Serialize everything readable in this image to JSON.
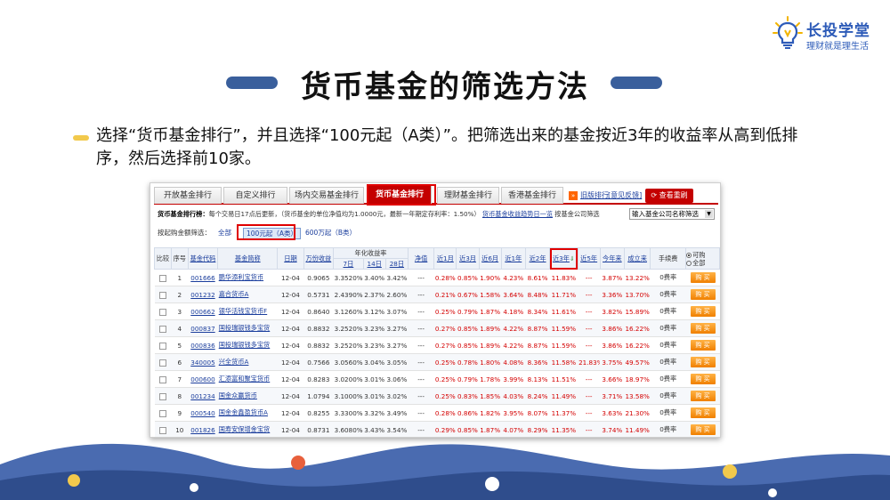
{
  "logo": {
    "brand": "长投学堂",
    "slogan": "理财就是理生活"
  },
  "title": "货币基金的筛选方法",
  "description": "选择“货币基金排行”，并且选择“100元起（A类）”。把筛选出来的基金按近3年的收益率从高到低排序，然后选择前10家。",
  "tabs": [
    {
      "label": "开放基金排行"
    },
    {
      "label": "自定义排行"
    },
    {
      "label": "场内交易基金排行"
    },
    {
      "label": "货币基金排行"
    },
    {
      "label": "理财基金排行"
    },
    {
      "label": "香港基金排行"
    }
  ],
  "tab_links": {
    "prev": "旧版排行",
    "feedback": "[意见反馈]",
    "red_button": "查看重刷"
  },
  "info": {
    "heading": "货币基金排行榜：",
    "text": "每个交易日17点后更新，（货币基金的单位净值均为1.0000元，最新一年期定存利率：1.50%）",
    "link": "货币基金收益趋势日一览",
    "company_label": "按基金公司筛选",
    "company_select": "输入基金公司名称筛选"
  },
  "filter": {
    "label": "按起购金额筛选：",
    "options": [
      "全部",
      "100元起（A类）",
      "600万起（B类）"
    ]
  },
  "table": {
    "headers": {
      "compare": "比较",
      "seq": "序号",
      "code": "基金代码",
      "name": "基金简称",
      "date": "日期",
      "wan": "万份收益",
      "annual": "年化收益率",
      "d7": "7日",
      "d14": "14日",
      "d28": "28日",
      "nav": "净值",
      "m1": "近1月",
      "m3": "近3月",
      "m6": "近6月",
      "y1": "近1年",
      "y2": "近2年",
      "y3": "近3年",
      "y5": "近5年",
      "ytd": "今年来",
      "since": "成立来",
      "fee": "手续费",
      "opt_buy": "可购",
      "opt_all": "全部"
    },
    "buy_label": "购 买",
    "rows": [
      {
        "seq": "1",
        "code": "001666",
        "name": "鹏华添利宝货币",
        "date": "12-04",
        "wan": "0.9065",
        "d7": "3.3520%",
        "d14": "3.40%",
        "d28": "3.42%",
        "nav": "---",
        "m1": "0.28%",
        "m3": "0.85%",
        "m6": "1.90%",
        "y1": "4.23%",
        "y2": "8.61%",
        "y3": "11.83%",
        "y5": "---",
        "ytd": "3.87%",
        "since": "13.22%",
        "fee": "0费率"
      },
      {
        "seq": "2",
        "code": "001232",
        "name": "嘉合货币A",
        "date": "12-04",
        "wan": "0.5731",
        "d7": "2.4390%",
        "d14": "2.37%",
        "d28": "2.60%",
        "nav": "---",
        "m1": "0.21%",
        "m3": "0.67%",
        "m6": "1.58%",
        "y1": "3.64%",
        "y2": "8.48%",
        "y3": "11.71%",
        "y5": "---",
        "ytd": "3.36%",
        "since": "13.70%",
        "fee": "0费率"
      },
      {
        "seq": "3",
        "code": "000662",
        "name": "银华活钱宝货币F",
        "date": "12-04",
        "wan": "0.8640",
        "d7": "3.1260%",
        "d14": "3.12%",
        "d28": "3.07%",
        "nav": "---",
        "m1": "0.25%",
        "m3": "0.79%",
        "m6": "1.87%",
        "y1": "4.18%",
        "y2": "8.34%",
        "y3": "11.61%",
        "y5": "---",
        "ytd": "3.82%",
        "since": "15.89%",
        "fee": "0费率"
      },
      {
        "seq": "4",
        "code": "000837",
        "name": "国投瑞银钱多宝货",
        "date": "12-04",
        "wan": "0.8832",
        "d7": "3.2520%",
        "d14": "3.23%",
        "d28": "3.27%",
        "nav": "---",
        "m1": "0.27%",
        "m3": "0.85%",
        "m6": "1.89%",
        "y1": "4.22%",
        "y2": "8.87%",
        "y3": "11.59%",
        "y5": "---",
        "ytd": "3.86%",
        "since": "16.22%",
        "fee": "0费率"
      },
      {
        "seq": "5",
        "code": "000836",
        "name": "国投瑞银钱多宝货",
        "date": "12-04",
        "wan": "0.8832",
        "d7": "3.2520%",
        "d14": "3.23%",
        "d28": "3.27%",
        "nav": "---",
        "m1": "0.27%",
        "m3": "0.85%",
        "m6": "1.89%",
        "y1": "4.22%",
        "y2": "8.87%",
        "y3": "11.59%",
        "y5": "---",
        "ytd": "3.86%",
        "since": "16.22%",
        "fee": "0费率"
      },
      {
        "seq": "6",
        "code": "340005",
        "name": "兴全货币A",
        "date": "12-04",
        "wan": "0.7566",
        "d7": "3.0560%",
        "d14": "3.04%",
        "d28": "3.05%",
        "nav": "---",
        "m1": "0.25%",
        "m3": "0.78%",
        "m6": "1.80%",
        "y1": "4.08%",
        "y2": "8.36%",
        "y3": "11.58%",
        "y5": "21.83%",
        "ytd": "3.75%",
        "since": "49.57%",
        "fee": "0费率"
      },
      {
        "seq": "7",
        "code": "000600",
        "name": "汇添富和聚宝货币",
        "date": "12-04",
        "wan": "0.8283",
        "d7": "3.0200%",
        "d14": "3.01%",
        "d28": "3.06%",
        "nav": "---",
        "m1": "0.25%",
        "m3": "0.79%",
        "m6": "1.78%",
        "y1": "3.99%",
        "y2": "8.13%",
        "y3": "11.51%",
        "y5": "---",
        "ytd": "3.66%",
        "since": "18.97%",
        "fee": "0费率"
      },
      {
        "seq": "8",
        "code": "001234",
        "name": "国金众赢货币",
        "date": "12-04",
        "wan": "1.0794",
        "d7": "3.1000%",
        "d14": "3.01%",
        "d28": "3.02%",
        "nav": "---",
        "m1": "0.25%",
        "m3": "0.83%",
        "m6": "1.85%",
        "y1": "4.03%",
        "y2": "8.24%",
        "y3": "11.49%",
        "y5": "---",
        "ytd": "3.71%",
        "since": "13.58%",
        "fee": "0费率"
      },
      {
        "seq": "9",
        "code": "000540",
        "name": "国金金鑫盈货币A",
        "date": "12-04",
        "wan": "0.8255",
        "d7": "3.3300%",
        "d14": "3.32%",
        "d28": "3.49%",
        "nav": "---",
        "m1": "0.28%",
        "m3": "0.86%",
        "m6": "1.82%",
        "y1": "3.95%",
        "y2": "8.07%",
        "y3": "11.37%",
        "y5": "---",
        "ytd": "3.63%",
        "since": "21.30%",
        "fee": "0费率"
      },
      {
        "seq": "10",
        "code": "001826",
        "name": "国寿安保增金宝货",
        "date": "12-04",
        "wan": "0.8731",
        "d7": "3.6080%",
        "d14": "3.43%",
        "d28": "3.54%",
        "nav": "---",
        "m1": "0.29%",
        "m3": "0.85%",
        "m6": "1.87%",
        "y1": "4.07%",
        "y2": "8.29%",
        "y3": "11.35%",
        "y5": "---",
        "ytd": "3.74%",
        "since": "11.49%",
        "fee": "0费率"
      }
    ]
  },
  "colors": {
    "accent": "#c40000",
    "title_pill": "#3a5f9c",
    "bullet": "#f2c94c",
    "link": "#1a3d9c"
  }
}
